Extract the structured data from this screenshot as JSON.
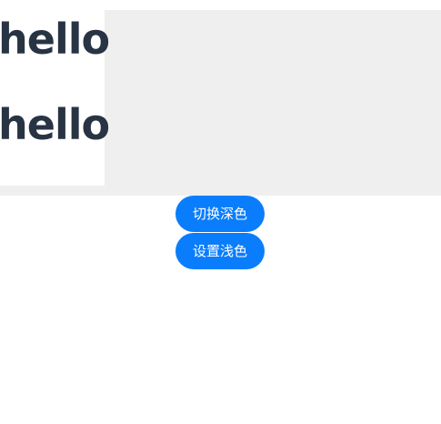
{
  "content": {
    "lines": [
      "hello",
      "hello"
    ]
  },
  "buttons": {
    "dark_label": "切换深色",
    "light_label": "设置浅色"
  },
  "colors": {
    "panel_bg": "#efefef",
    "text": "#283444",
    "button_bg": "#0a7dfc",
    "button_text": "#ffffff"
  }
}
